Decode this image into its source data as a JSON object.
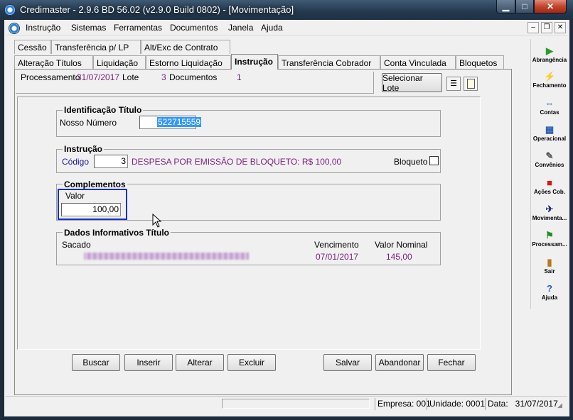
{
  "window": {
    "title": "Credimaster - 2.9.6 BD 56.02 (v2.9.0 Build 0802) - [Movimentação]",
    "minimize": "▁",
    "maximize": "□",
    "close": "✕"
  },
  "menu": [
    "Instrução",
    "Sistemas",
    "Ferramentas",
    "Documentos",
    "Janela",
    "Ajuda"
  ],
  "mdi_buttons": [
    "–",
    "❐",
    "✕"
  ],
  "tabs_row1": [
    "Cessão",
    "Transferência p/ LP",
    "Alt/Exc de Contrato"
  ],
  "tabs_row2": [
    "Alteração Títulos",
    "Liquidação",
    "Estorno Liquidação",
    "Instrução",
    "Transferência Cobrador",
    "Conta Vinculada",
    "Bloquetos"
  ],
  "active_tab": "Instrução",
  "processamento": {
    "label": "Processamento",
    "date": "31/07/2017",
    "lote_label": "Lote",
    "lote_value": "3",
    "documentos_label": "Documentos",
    "documentos_value": "1"
  },
  "selecionar_lote": "Selecionar Lote",
  "identificacao": {
    "title": "Identificação Título",
    "nosso_numero_label": "Nosso Número",
    "nosso_numero_value": "522715559"
  },
  "instrucao": {
    "title": "Instrução",
    "codigo_label": "Código",
    "codigo_value": "3",
    "descricao": "DESPESA POR EMISSÃO DE BLOQUETO: R$ 100,00",
    "bloqueto_label": "Bloqueto"
  },
  "complementos": {
    "title": "Complementos",
    "valor_label": "Valor",
    "valor_value": "100,00"
  },
  "dados": {
    "title": "Dados Informativos Título",
    "sacado_label": "Sacado",
    "vencimento_label": "Vencimento",
    "vencimento_value": "07/01/2017",
    "valor_nominal_label": "Valor Nominal",
    "valor_nominal_value": "145,00"
  },
  "buttons": [
    "Buscar",
    "Inserir",
    "Alterar",
    "Excluir",
    "Salvar",
    "Abandonar",
    "Fechar"
  ],
  "toolbar": [
    {
      "label": "Abrangência",
      "icon": "abrangencia-icon",
      "glyph": "▶",
      "color": "#2a9a2a"
    },
    {
      "label": "Fechamento",
      "icon": "fechamento-icon",
      "glyph": "⚡",
      "color": "#d02020"
    },
    {
      "label": "Contas",
      "icon": "contas-icon",
      "glyph": "⇔",
      "color": "#2b5fb0"
    },
    {
      "label": "Operacional",
      "icon": "operacional-icon",
      "glyph": "▦",
      "color": "#2b5fb0"
    },
    {
      "label": "Convênios",
      "icon": "convenios-icon",
      "glyph": "✎",
      "color": "#555555"
    },
    {
      "label": "Ações Cob.",
      "icon": "acoes-cob-icon",
      "glyph": "■",
      "color": "#d81818"
    },
    {
      "label": "Movimenta...",
      "icon": "movimenta-icon",
      "glyph": "✈",
      "color": "#1c2e6e"
    },
    {
      "label": "Processam...",
      "icon": "processam-icon",
      "glyph": "⚑",
      "color": "#2a8a2a"
    },
    {
      "label": "Sair",
      "icon": "sair-icon",
      "glyph": "▮",
      "color": "#b87820"
    },
    {
      "label": "Ajuda",
      "icon": "ajuda-icon",
      "glyph": "?",
      "color": "#1f5fb8"
    }
  ],
  "status": {
    "empresa": "Empresa: 001",
    "unidade": "Unidade: 0001",
    "data": "Data:   31/07/2017"
  }
}
